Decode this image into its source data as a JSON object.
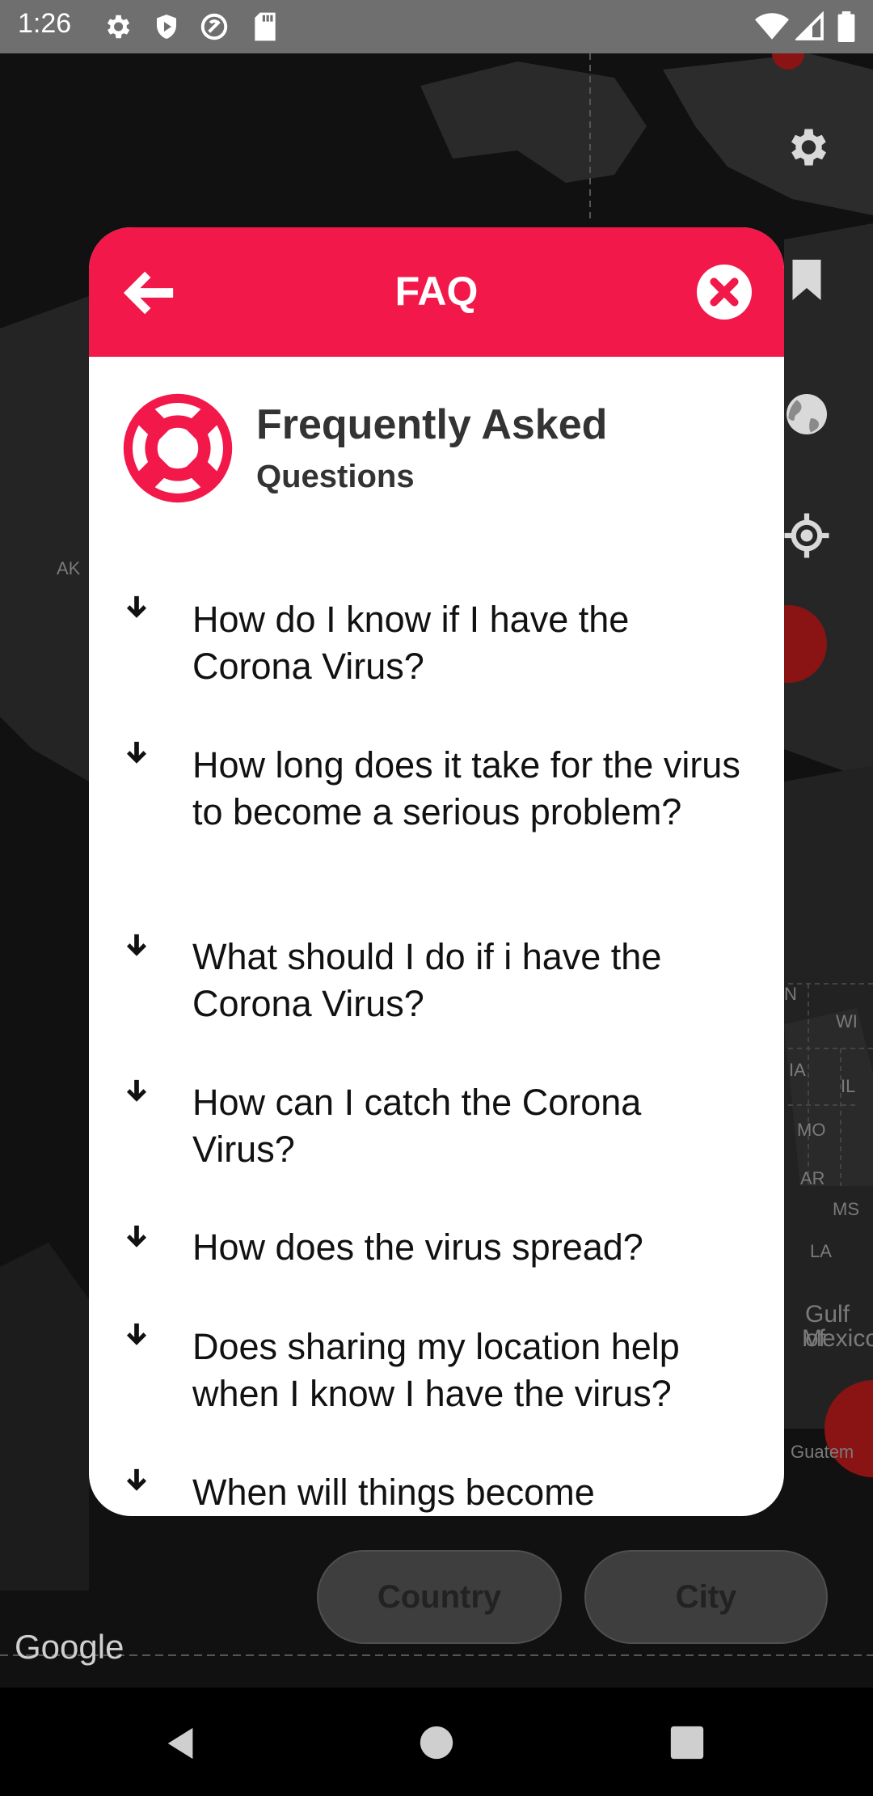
{
  "status_bar": {
    "time": "1:26"
  },
  "map": {
    "labels": [
      "AK",
      "N",
      "WI",
      "IA",
      "IL",
      "MO",
      "AR",
      "MS",
      "LA",
      "Gulf of",
      "Mexico",
      "Guatem"
    ],
    "google": "Google"
  },
  "bottom_buttons": {
    "country": "Country",
    "city": "City"
  },
  "dialog": {
    "title": "FAQ",
    "heading": "Frequently Asked",
    "subheading": "Questions",
    "questions": [
      "How do I know if I have the Corona Virus?",
      "How long does it take for the virus to become a serious problem?",
      "What should I do if i have the Corona Virus?",
      "How can I catch the Corona Virus?",
      "How does the virus spread?",
      "Does sharing my location help when I know I have the virus?",
      "When will things become"
    ]
  },
  "colors": {
    "accent": "#f2184a",
    "map_background": "#111111"
  }
}
